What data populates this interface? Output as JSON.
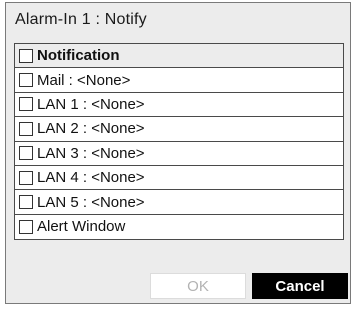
{
  "dialog": {
    "title": "Alarm-In 1 : Notify"
  },
  "list": {
    "header": "Notification",
    "items": [
      {
        "label": "Mail : <None>",
        "checked": false
      },
      {
        "label": "LAN 1 : <None>",
        "checked": false
      },
      {
        "label": "LAN 2 : <None>",
        "checked": false
      },
      {
        "label": "LAN 3 : <None>",
        "checked": false
      },
      {
        "label": "LAN 4 : <None>",
        "checked": false
      },
      {
        "label": "LAN 5 : <None>",
        "checked": false
      },
      {
        "label": "Alert Window",
        "checked": false
      }
    ]
  },
  "buttons": {
    "ok_label": "OK",
    "cancel_label": "Cancel"
  },
  "colors": {
    "dialog_background": "#ececec",
    "cancel_background": "#000000",
    "ok_text_disabled": "#b3b3b3"
  }
}
